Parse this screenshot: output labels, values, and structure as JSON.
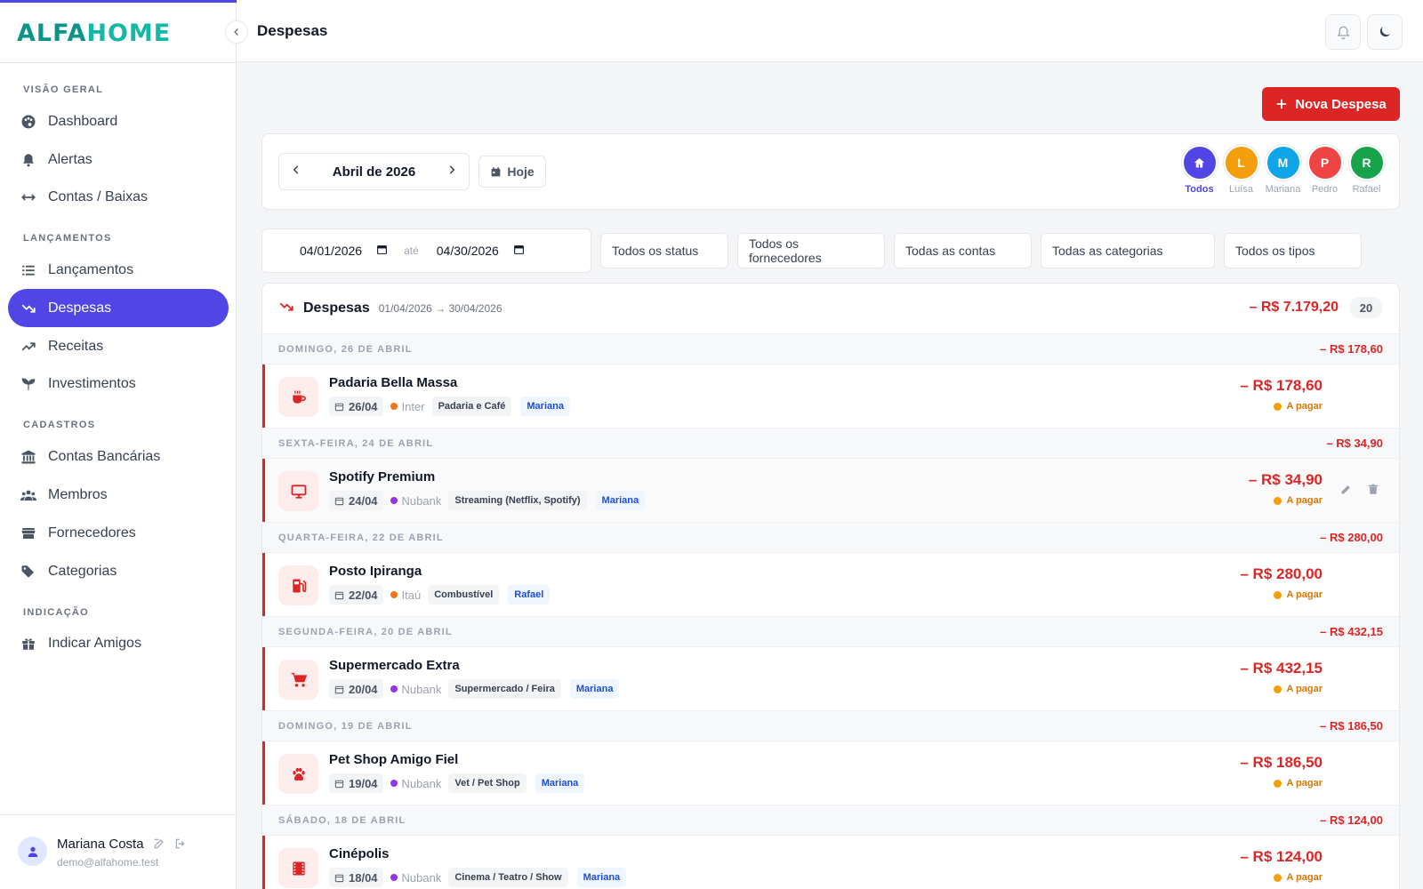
{
  "app": {
    "logo_part1": "ALFA",
    "logo_part2": "HOME",
    "accent": "#4f46e5",
    "expense_color": "#dc2626"
  },
  "sidebar": {
    "sections": [
      {
        "label": "VISÃO GERAL",
        "items": [
          {
            "label": "Dashboard",
            "icon": "palette-icon"
          },
          {
            "label": "Alertas",
            "icon": "bell-icon"
          },
          {
            "label": "Contas / Baixas",
            "icon": "arrows-horizontal-icon"
          }
        ]
      },
      {
        "label": "LANÇAMENTOS",
        "items": [
          {
            "label": "Lançamentos",
            "icon": "list-icon"
          },
          {
            "label": "Despesas",
            "icon": "trending-down-icon",
            "active": true
          },
          {
            "label": "Receitas",
            "icon": "trending-up-icon"
          },
          {
            "label": "Investimentos",
            "icon": "sprout-icon"
          }
        ]
      },
      {
        "label": "CADASTROS",
        "items": [
          {
            "label": "Contas Bancárias",
            "icon": "bank-icon"
          },
          {
            "label": "Membros",
            "icon": "group-icon"
          },
          {
            "label": "Fornecedores",
            "icon": "store-icon"
          },
          {
            "label": "Categorias",
            "icon": "tags-icon"
          }
        ]
      },
      {
        "label": "INDICAÇÃO",
        "items": [
          {
            "label": "Indicar Amigos",
            "icon": "gift-icon"
          }
        ]
      }
    ]
  },
  "user": {
    "name": "Mariana Costa",
    "email": "demo@alfahome.test"
  },
  "header": {
    "title": "Despesas"
  },
  "actions": {
    "new_expense": "Nova Despesa"
  },
  "period": {
    "month": "Abril de 2026",
    "today": "Hoje"
  },
  "members": [
    {
      "name": "Todos",
      "initial": "",
      "color": "#4f46e5",
      "selected": true
    },
    {
      "name": "Luísa",
      "initial": "L",
      "color": "#f59e0b"
    },
    {
      "name": "Mariana",
      "initial": "M",
      "color": "#0ea5e9"
    },
    {
      "name": "Pedro",
      "initial": "P",
      "color": "#ef4444"
    },
    {
      "name": "Rafael",
      "initial": "R",
      "color": "#16a34a"
    }
  ],
  "filters": {
    "date_from": "04/01/2026",
    "date_sep": "até",
    "date_to": "04/30/2026",
    "status": "Todos os status",
    "suppliers": "Todos os fornecedores",
    "accounts": "Todas as contas",
    "categories": "Todas as categorias",
    "types": "Todos os tipos"
  },
  "list": {
    "title": "Despesas",
    "range": "01/04/2026 → 30/04/2026",
    "total": "– R$ 7.179,20",
    "count": "20",
    "groups": [
      {
        "date": "DOMINGO, 26 DE ABRIL",
        "sum": "– R$ 178,60",
        "item": {
          "name": "Padaria Bella Massa",
          "day": "26/04",
          "bank": "Inter",
          "bank_color": "#f97316",
          "category": "Padaria e Café",
          "member": "Mariana",
          "amount": "– R$ 178,60",
          "status": "A pagar",
          "icon": "coffee-icon"
        }
      },
      {
        "date": "SEXTA-FEIRA, 24 DE ABRIL",
        "sum": "– R$ 34,90",
        "item": {
          "name": "Spotify Premium",
          "day": "24/04",
          "bank": "Nubank",
          "bank_color": "#9333ea",
          "category": "Streaming (Netflix, Spotify)",
          "member": "Mariana",
          "amount": "– R$ 34,90",
          "status": "A pagar",
          "icon": "monitor-icon"
        }
      },
      {
        "date": "QUARTA-FEIRA, 22 DE ABRIL",
        "sum": "– R$ 280,00",
        "item": {
          "name": "Posto Ipiranga",
          "day": "22/04",
          "bank": "Itaú",
          "bank_color": "#f97316",
          "category": "Combustível",
          "member": "Rafael",
          "amount": "– R$ 280,00",
          "status": "A pagar",
          "icon": "fuel-icon"
        }
      },
      {
        "date": "SEGUNDA-FEIRA, 20 DE ABRIL",
        "sum": "– R$ 432,15",
        "item": {
          "name": "Supermercado Extra",
          "day": "20/04",
          "bank": "Nubank",
          "bank_color": "#9333ea",
          "category": "Supermercado / Feira",
          "member": "Mariana",
          "amount": "– R$ 432,15",
          "status": "A pagar",
          "icon": "cart-icon"
        }
      },
      {
        "date": "DOMINGO, 19 DE ABRIL",
        "sum": "– R$ 186,50",
        "item": {
          "name": "Pet Shop Amigo Fiel",
          "day": "19/04",
          "bank": "Nubank",
          "bank_color": "#9333ea",
          "category": "Vet / Pet Shop",
          "member": "Mariana",
          "amount": "– R$ 186,50",
          "status": "A pagar",
          "icon": "paw-icon"
        }
      },
      {
        "date": "SÁBADO, 18 DE ABRIL",
        "sum": "– R$ 124,00",
        "item": {
          "name": "Cinépolis",
          "day": "18/04",
          "bank": "Nubank",
          "bank_color": "#9333ea",
          "category": "Cinema / Teatro / Show",
          "member": "Mariana",
          "amount": "– R$ 124,00",
          "status": "A pagar",
          "icon": "film-icon"
        }
      }
    ]
  }
}
